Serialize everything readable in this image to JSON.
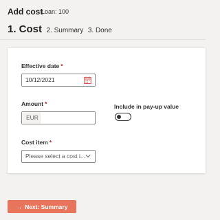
{
  "header": {
    "title": "Add cost",
    "loan": "Loan: 100"
  },
  "steps": {
    "active": "1. Cost",
    "items": [
      "2. Summary",
      "3. Done"
    ]
  },
  "form": {
    "effective_date": {
      "label": "Effective date",
      "required_mark": "*",
      "value": "10/12/2021",
      "icon": "calendar-icon"
    },
    "amount": {
      "label": "Amount",
      "required_mark": "*",
      "currency": "EUR",
      "value": ""
    },
    "pay_up": {
      "label": "Include in pay-up value",
      "on": false
    },
    "cost_item": {
      "label": "Cost item",
      "required_mark": "*",
      "placeholder": "Please select a cost i...",
      "icon": "chevron-down-icon"
    }
  },
  "footer": {
    "next_arrow": "→",
    "next_label": "Next: Summary",
    "button_color": "#e8745b"
  }
}
